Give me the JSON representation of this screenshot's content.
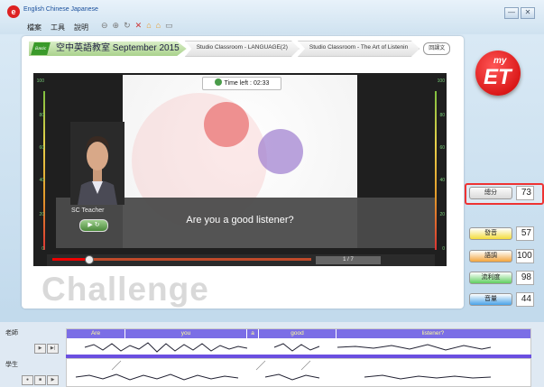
{
  "window": {
    "language_links": "English Chinese Japanese",
    "menu": [
      "檔案",
      "工具",
      "說明"
    ],
    "controls": [
      "—",
      "✕"
    ]
  },
  "tabs": {
    "primary": "空中英語教室 September 2015",
    "primary_badge": "Basic",
    "secondary": [
      "Studio Classroom - LANGUAGE(2)",
      "Studio Classroom - The Art of Listenin"
    ],
    "button": "回課文"
  },
  "player": {
    "time_left_label": "Time left :",
    "time_left_value": "02:33",
    "teacher_name": "SC Teacher",
    "sentence": "Are you a good listener?",
    "page_counter": "1 / 7",
    "progress": 0.14,
    "meter_labels": [
      "100",
      "80",
      "60",
      "40",
      "20",
      "0"
    ]
  },
  "mode_label": "Challenge",
  "scores": {
    "total": {
      "label": "總分",
      "value": "73"
    },
    "items": [
      {
        "label": "發音",
        "value": "57",
        "color": "#f3dc3c"
      },
      {
        "label": "語調",
        "value": "100",
        "color": "#f3a43c"
      },
      {
        "label": "流利度",
        "value": "98",
        "color": "#5fcf5f"
      },
      {
        "label": "音量",
        "value": "44",
        "color": "#4aa3e8"
      }
    ]
  },
  "waveform": {
    "teacher_label": "老師",
    "student_label": "學生",
    "words": [
      "Are",
      "you",
      "a",
      "good",
      "listener?"
    ]
  }
}
